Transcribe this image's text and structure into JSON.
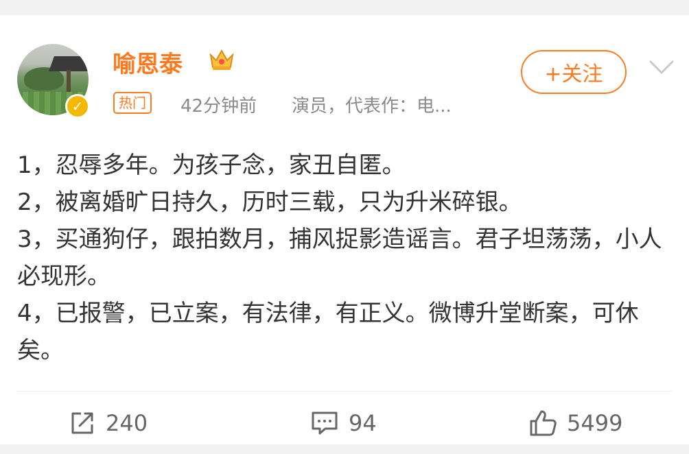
{
  "post": {
    "author": {
      "name": "喻恩泰",
      "hot_badge": "热门",
      "time": "42分钟前",
      "description": "演员，代表作：电..."
    },
    "follow_label": "+关注",
    "paragraphs": [
      "1，忍辱多年。为孩子念，家丑自匿。",
      "2，被离婚旷日持久，历时三载，只为升米碎银。",
      "3，买通狗仔，跟拍数月，捕风捉影造谣言。君子坦荡荡，小人必现形。",
      "4，已报警，已立案，有法律，有正义。微博升堂断案，可休矣。"
    ],
    "actions": {
      "repost_count": "240",
      "comment_count": "94",
      "like_count": "5499"
    }
  },
  "icons": {
    "avatar": "avatar-image",
    "verified": "verified-badge-icon",
    "crown": "crown-icon",
    "more": "chevron-down-icon",
    "repost": "repost-icon",
    "comment": "comment-icon",
    "like": "thumbs-up-icon"
  },
  "colors": {
    "accent": "#ff7a1f",
    "meta_text": "#8a8a8a",
    "body_text": "#333333",
    "verified": "#f5b800"
  }
}
